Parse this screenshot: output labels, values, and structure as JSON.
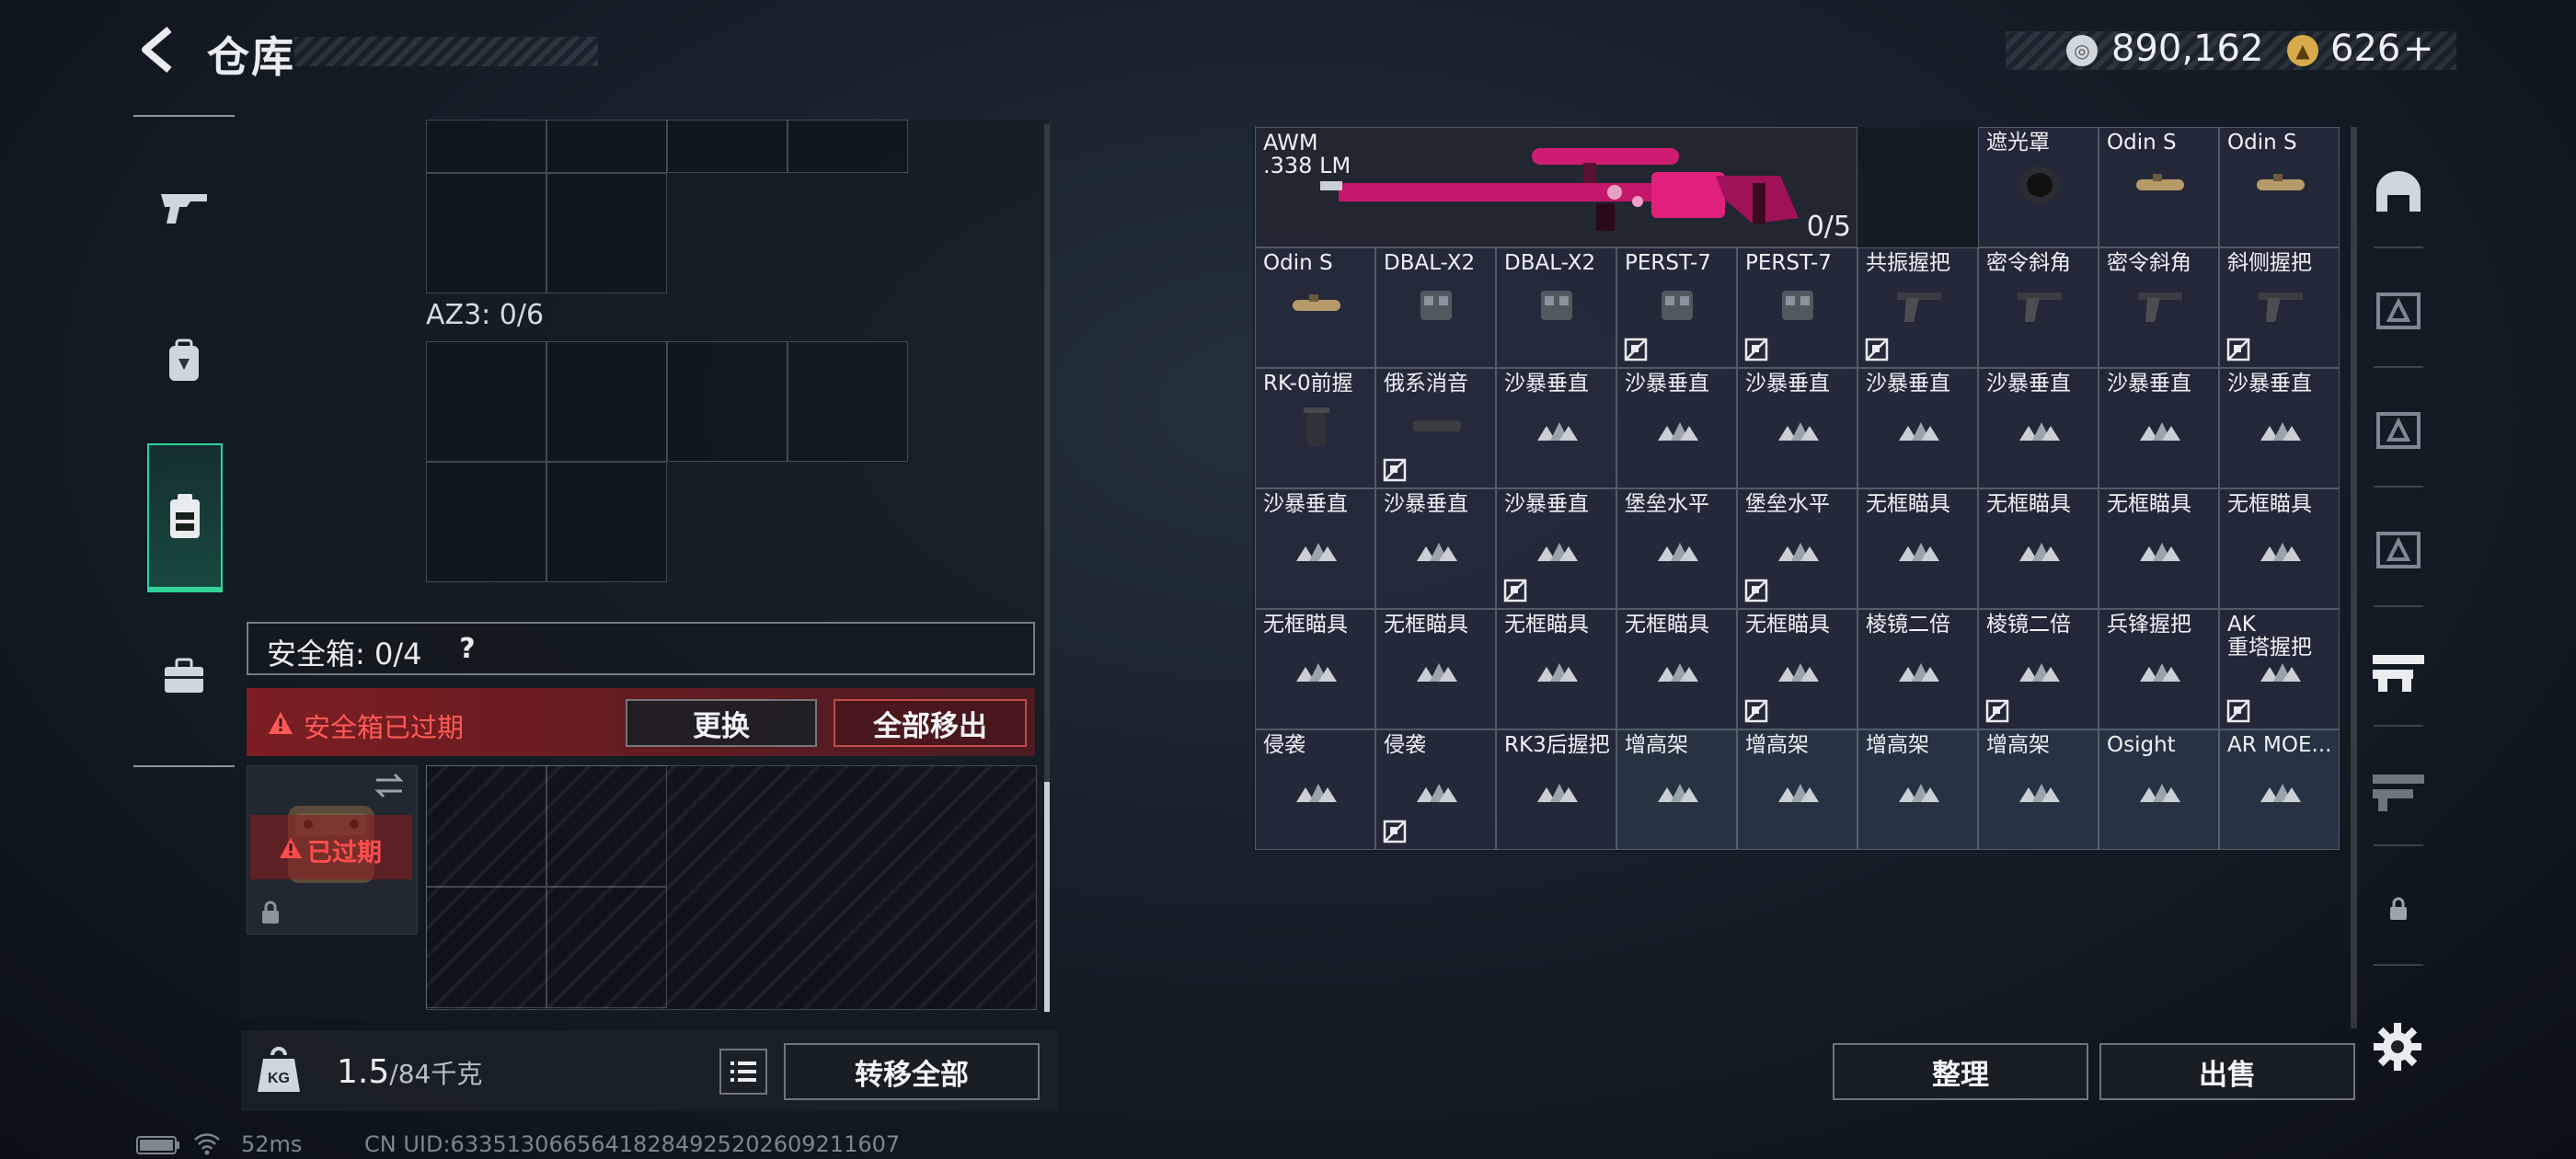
{
  "header": {
    "title": "仓库"
  },
  "currency": {
    "silver": "890,162",
    "gold": "626",
    "gold_add": "+"
  },
  "left_nav": [
    "gun-icon",
    "backpack-icon",
    "vest-icon",
    "toolbox-icon"
  ],
  "storage": {
    "az3_label": "AZ3: 0/6",
    "safe_label": "安全箱: 0/4",
    "safe_help": "?",
    "warning": "安全箱已过期",
    "replace_button": "更换",
    "remove_all_button": "全部移出",
    "case_status": "已过期"
  },
  "bottom": {
    "weight_current": "1.5",
    "weight_max": "/84千克",
    "transfer_all": "转移全部",
    "organize": "整理",
    "sell": "出售"
  },
  "status": {
    "ping": "52ms",
    "uid": "CN UID:6335130665641828492520260921​1607"
  },
  "inventory": {
    "awm": {
      "name": "AWM\n.338 LM",
      "count": "0/5"
    },
    "slots": [
      {
        "label": "遮光罩",
        "icon": "lens-hood"
      },
      {
        "label": "Odin S",
        "icon": "scope"
      },
      {
        "label": "Odin S",
        "icon": "scope"
      },
      {
        "label": "Odin S",
        "icon": "scope"
      },
      {
        "label": "DBAL-X2",
        "icon": "laser"
      },
      {
        "label": "DBAL-X2",
        "icon": "laser"
      },
      {
        "label": "PERST-7",
        "icon": "laser",
        "nomod": true
      },
      {
        "label": "PERST-7",
        "icon": "laser",
        "nomod": true
      },
      {
        "label": "共振握把",
        "icon": "grip",
        "nomod": true
      },
      {
        "label": "密令斜角",
        "icon": "angled-grip"
      },
      {
        "label": "密令斜角",
        "icon": "angled-grip"
      },
      {
        "label": "斜侧握把",
        "icon": "grip",
        "nomod": true
      },
      {
        "label": "RK-0前握",
        "icon": "vertical-grip"
      },
      {
        "label": "俄系消音",
        "icon": "suppressor",
        "nomod": true
      },
      {
        "label": "沙暴垂直",
        "icon": "placeholder"
      },
      {
        "label": "沙暴垂直",
        "icon": "placeholder"
      },
      {
        "label": "沙暴垂直",
        "icon": "placeholder"
      },
      {
        "label": "沙暴垂直",
        "icon": "placeholder"
      },
      {
        "label": "沙暴垂直",
        "icon": "placeholder"
      },
      {
        "label": "沙暴垂直",
        "icon": "placeholder"
      },
      {
        "label": "沙暴垂直",
        "icon": "placeholder"
      },
      {
        "label": "沙暴垂直",
        "icon": "placeholder"
      },
      {
        "label": "沙暴垂直",
        "icon": "placeholder"
      },
      {
        "label": "沙暴垂直",
        "icon": "placeholder",
        "nomod": true
      },
      {
        "label": "堡垒水平",
        "icon": "placeholder"
      },
      {
        "label": "堡垒水平",
        "icon": "placeholder",
        "nomod": true
      },
      {
        "label": "无框瞄具",
        "icon": "placeholder"
      },
      {
        "label": "无框瞄具",
        "icon": "placeholder"
      },
      {
        "label": "无框瞄具",
        "icon": "placeholder"
      },
      {
        "label": "无框瞄具",
        "icon": "placeholder"
      },
      {
        "label": "无框瞄具",
        "icon": "placeholder"
      },
      {
        "label": "无框瞄具",
        "icon": "placeholder"
      },
      {
        "label": "无框瞄具",
        "icon": "placeholder"
      },
      {
        "label": "无框瞄具",
        "icon": "placeholder"
      },
      {
        "label": "无框瞄具",
        "icon": "placeholder",
        "nomod": true
      },
      {
        "label": "棱镜二倍",
        "icon": "placeholder"
      },
      {
        "label": "棱镜二倍",
        "icon": "placeholder",
        "nomod": true
      },
      {
        "label": "兵锋握把",
        "icon": "placeholder"
      },
      {
        "label": "AK\n重塔握把",
        "icon": "placeholder",
        "nomod": true
      },
      {
        "label": "侵袭",
        "icon": "placeholder"
      },
      {
        "label": "侵袭",
        "icon": "placeholder",
        "nomod": true
      },
      {
        "label": "RK3后握把",
        "icon": "placeholder"
      },
      {
        "label": "增高架",
        "icon": "placeholder",
        "hl": true
      },
      {
        "label": "增高架",
        "icon": "placeholder",
        "hl": true
      },
      {
        "label": "增高架",
        "icon": "placeholder",
        "hl": true
      },
      {
        "label": "增高架",
        "icon": "placeholder",
        "hl": true
      },
      {
        "label": "Osight",
        "icon": "placeholder",
        "hl": true
      },
      {
        "label": "AR MOE...",
        "icon": "placeholder",
        "hl": true
      }
    ]
  },
  "colors": {
    "accent": "#2fd39a",
    "warning": "#ff5a55",
    "weapon": "#e0207a"
  }
}
